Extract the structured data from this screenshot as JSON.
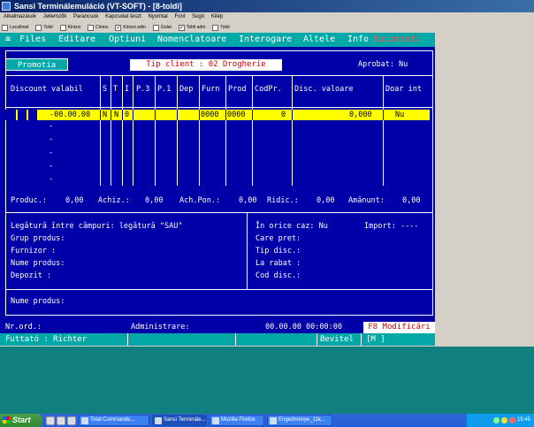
{
  "window": {
    "title": "Sansi Terminálemuláció (VT-SOFT) - [8-toldi]",
    "menu": [
      "Alkalmazások",
      "Jellemzők",
      "Parancsok",
      "Kapcsolat teszt",
      "Nyomtat",
      "Font",
      "Súgó",
      "Kilép"
    ],
    "toolbar": [
      {
        "label": "Localhost",
        "checked": false
      },
      {
        "label": "Toldi",
        "checked": false
      },
      {
        "label": "Kinizsi",
        "checked": false
      },
      {
        "label": "Cimox",
        "checked": false
      },
      {
        "label": "Kinizsi adm",
        "checked": true
      },
      {
        "label": "Golat",
        "checked": false
      },
      {
        "label": "Toldi adm",
        "checked": true
      },
      {
        "label": "Toldi",
        "checked": false
      }
    ]
  },
  "terminal": {
    "menu": [
      "Files",
      "Editare",
      "Optiuni",
      "Nomenclatoare",
      "Interogare",
      "Altele",
      "Info"
    ],
    "location": "Bucuresti",
    "promo": "Promotia",
    "tip_client": "Tip client : 02 Drogherie",
    "aprobat": "Aprobat: Nu",
    "columns": [
      "Discount valabil",
      "S",
      "T",
      "I",
      "P.3",
      "P.1",
      "Dep",
      "Furn",
      "Prod",
      "CodPr.",
      "Disc. valoare",
      "Doar int"
    ],
    "row": {
      "date": "-00.00.00",
      "s": "N",
      "t": "N",
      "i": "0",
      "furn": "0000",
      "prod": "0000",
      "codpr": "0",
      "disc": "0,000",
      "doar": "Nu"
    },
    "dashes": [
      "-",
      "-",
      "-",
      "-",
      "-"
    ],
    "totals": {
      "produc_label": "Produc.:",
      "produc_val": "0,00",
      "achiz_label": "Achiz.:",
      "achiz_val": "0,00",
      "achpon_label": "Ach.Pon.:",
      "achpon_val": "0,00",
      "ridic_label": "Ridic.:",
      "ridic_val": "0,00",
      "amanunt_label": "Amănunt:",
      "amanunt_val": "0,00"
    },
    "legatura": "Legătură între cămpuri: legătură \"SAU\"",
    "left_fields": [
      "Grup produs:",
      "Furnizor    :",
      "Nume produs:",
      "Depozit     :"
    ],
    "in_orice_caz": "În orice caz: Nu",
    "import": "Import: ----",
    "right_fields": [
      "Care pret:",
      "Tip disc.:",
      "La rabat  :",
      "Cod disc.:"
    ],
    "nume_produs": "Nume produs:",
    "nr_ord": "Nr.ord.:",
    "administrare": "Administrare:",
    "datetime": "00.00.00 00:00:00",
    "f8": "F8 Modificări",
    "status_user": "Futtató : Richter",
    "status_mode": "Bevitel",
    "status_m": "[M    ]"
  },
  "taskbar": {
    "start": "Start",
    "tasks": [
      "Total Commande...",
      "Sansi Terminále...",
      "Mozilla Firefox",
      "Engedménye_11k..."
    ],
    "clock": "15:45"
  }
}
